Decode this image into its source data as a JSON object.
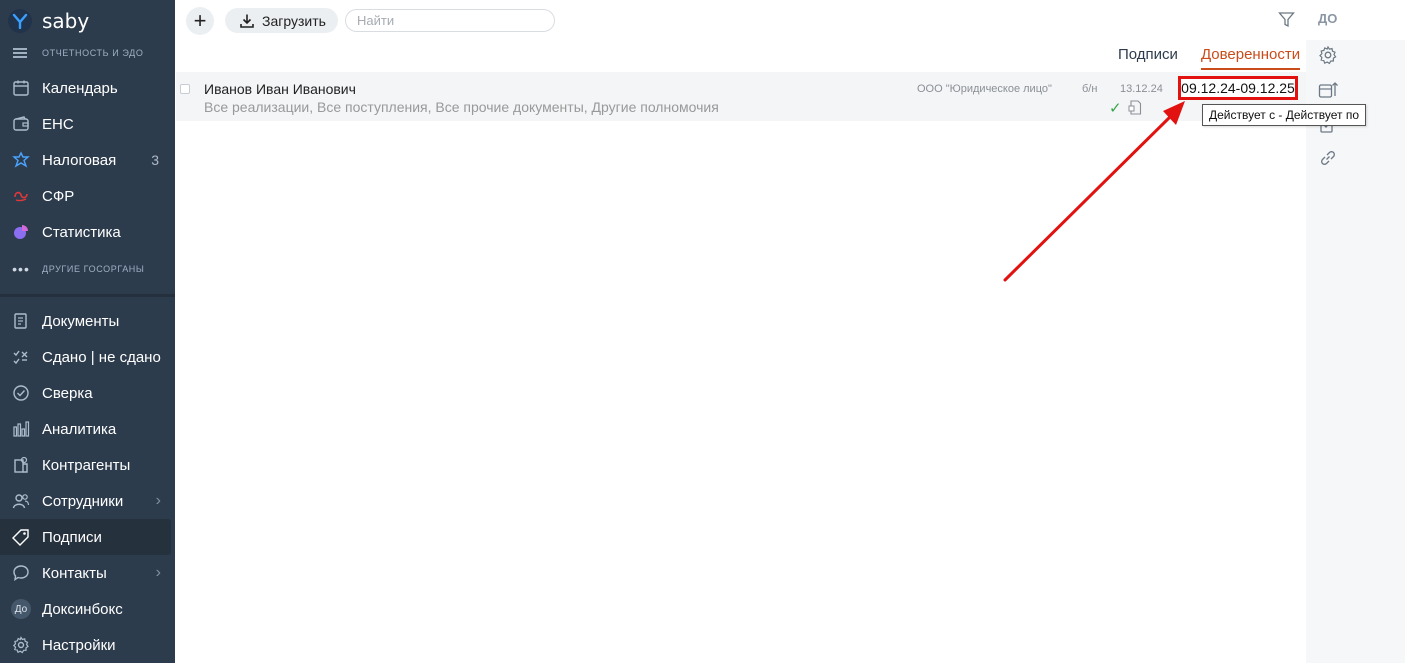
{
  "app": {
    "logo_text": "saby",
    "section_label": "ОТЧЕТНОСТЬ И ЭДО"
  },
  "sidebar": {
    "items_top": [
      {
        "label": "Календарь",
        "icon": "calendar-icon"
      },
      {
        "label": "ЕНС",
        "icon": "wallet-icon"
      },
      {
        "label": "Налоговая",
        "icon": "tax-icon",
        "count": "3"
      },
      {
        "label": "СФР",
        "icon": "sfr-icon"
      },
      {
        "label": "Статистика",
        "icon": "pie-chart-icon"
      }
    ],
    "more_label": "ДРУГИЕ ГОСОРГАНЫ",
    "items_bottom": [
      {
        "label": "Документы",
        "icon": "document-icon"
      },
      {
        "label": "Сдано | не сдано",
        "icon": "checklist-icon"
      },
      {
        "label": "Сверка",
        "icon": "verify-icon"
      },
      {
        "label": "Аналитика",
        "icon": "bar-chart-icon"
      },
      {
        "label": "Контрагенты",
        "icon": "building-icon"
      },
      {
        "label": "Сотрудники",
        "icon": "people-icon",
        "chevron": "›"
      },
      {
        "label": "Подписи",
        "icon": "tag-icon",
        "active": true
      },
      {
        "label": "Контакты",
        "icon": "chat-icon",
        "chevron": "›"
      },
      {
        "label": "Доксинбокс",
        "icon": "doxinbox-icon",
        "badge": "До"
      },
      {
        "label": "Настройки",
        "icon": "settings-gear-icon"
      }
    ]
  },
  "toolbar": {
    "add_label": "+",
    "upload_label": "Загрузить",
    "search_placeholder": "Найти",
    "do_label": "ДО"
  },
  "tabs": [
    {
      "label": "Подписи",
      "active": false
    },
    {
      "label": "Доверенности",
      "active": true
    }
  ],
  "rows": [
    {
      "name": "Иванов Иван Иванович",
      "description": "Все реализации, Все поступления, Все прочие документы, Другие полномочия",
      "organization": "ООО \"Юридическое лицо\"",
      "number": "б/н",
      "date": "13.12.24",
      "validity": "09.12.24-09.12.25"
    }
  ],
  "tooltip": "Действует с - Действует по",
  "colors": {
    "sidebar_bg": "#2d3c4d",
    "accent": "#c94c1a",
    "highlight": "#e1120f"
  }
}
